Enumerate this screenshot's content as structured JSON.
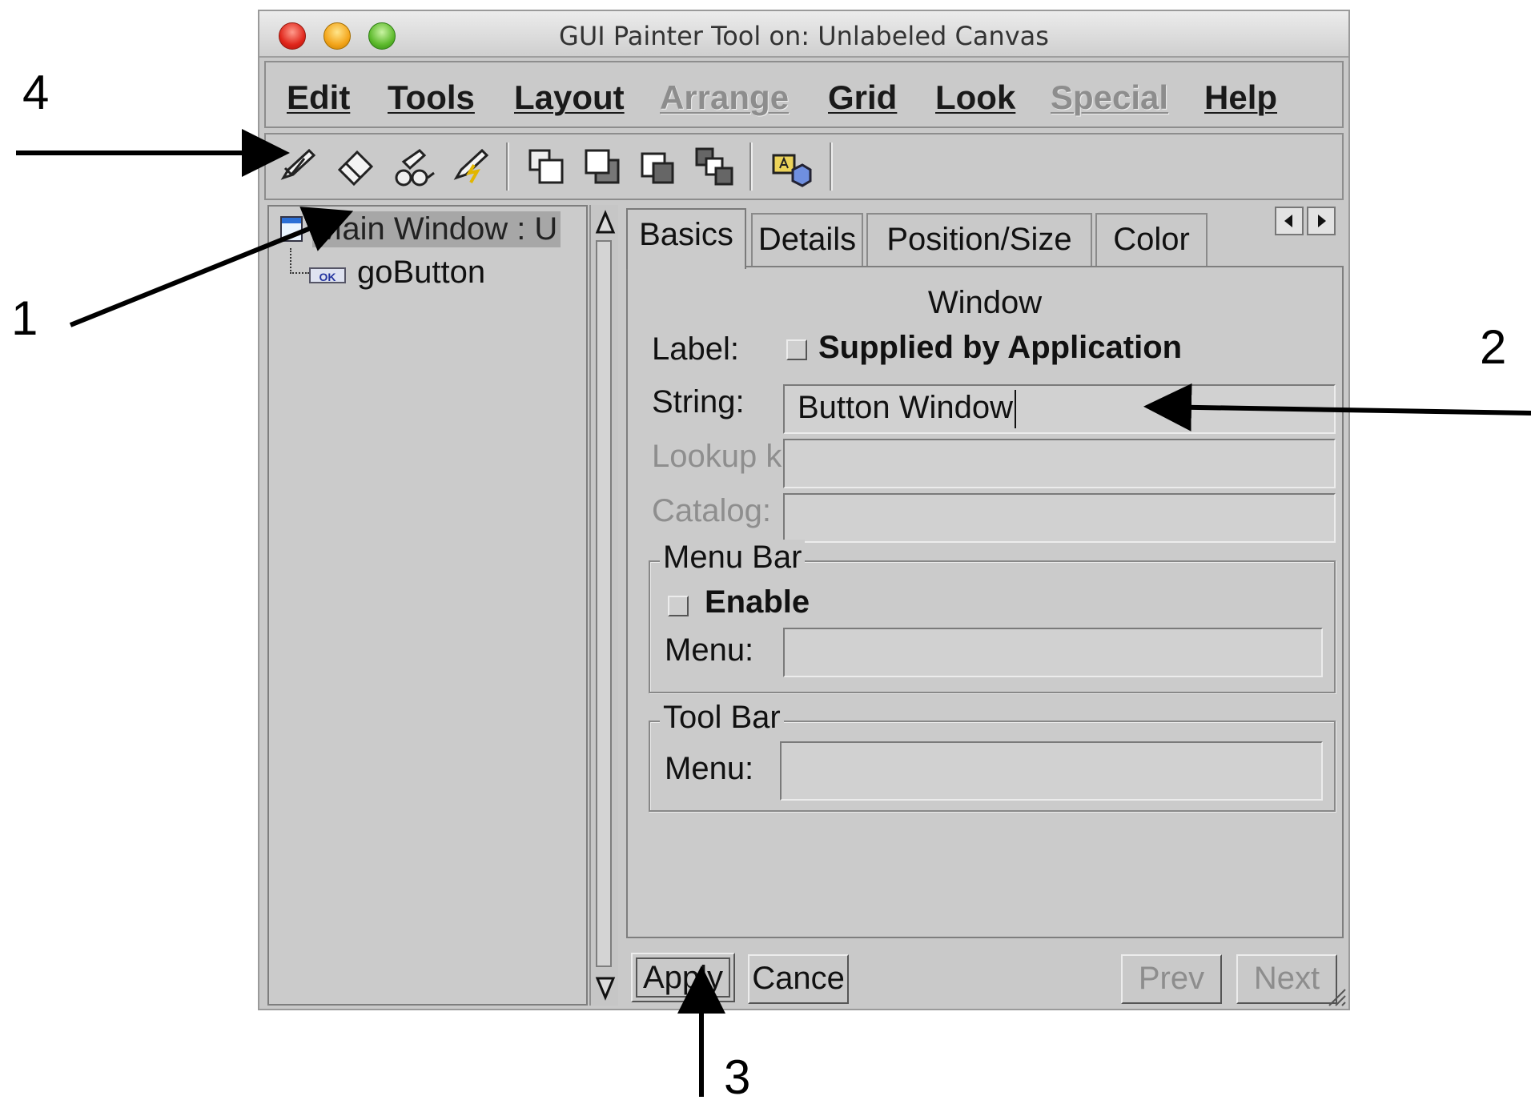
{
  "window": {
    "title": "GUI Painter Tool on: Unlabeled Canvas"
  },
  "menubar": {
    "items": [
      {
        "label": "Edit",
        "enabled": true
      },
      {
        "label": "Tools",
        "enabled": true
      },
      {
        "label": "Layout",
        "enabled": true
      },
      {
        "label": "Arrange",
        "enabled": false
      },
      {
        "label": "Grid",
        "enabled": true
      },
      {
        "label": "Look",
        "enabled": true
      },
      {
        "label": "Special",
        "enabled": false
      },
      {
        "label": "Help",
        "enabled": true
      }
    ]
  },
  "toolbar": {
    "tools": [
      "edit-pen-icon",
      "eraser-icon",
      "glasses-icon",
      "lightning-pen-icon",
      "bring-to-front-icon",
      "send-to-back-icon",
      "bring-forward-icon",
      "send-backward-icon",
      "resource-install-icon"
    ]
  },
  "tree": {
    "root_label": "Main Window : U",
    "child_badge": "OK",
    "child_label": "goButton"
  },
  "tabs": [
    {
      "label": "Basics",
      "active": true
    },
    {
      "label": "Details",
      "active": false
    },
    {
      "label": "Position/Size",
      "active": false
    },
    {
      "label": "Color",
      "active": false
    }
  ],
  "panel": {
    "heading": "Window",
    "label_label": "Label:",
    "supplied_checkbox_label": "Supplied by Application",
    "supplied_checked": false,
    "string_label": "String:",
    "string_value": "Button Window",
    "lookup_label": "Lookup key:",
    "lookup_value": "",
    "catalog_label": "Catalog:",
    "catalog_value": "",
    "menubar_group": {
      "title": "Menu Bar",
      "enable_label": "Enable",
      "enable_checked": false,
      "menu_label": "Menu:",
      "menu_value": ""
    },
    "toolbar_group": {
      "title": "Tool Bar",
      "menu_label": "Menu:",
      "menu_value": ""
    }
  },
  "buttons": {
    "apply": "Apply",
    "cancel": "Cance",
    "prev": "Prev",
    "next": "Next"
  },
  "callouts": [
    "1",
    "2",
    "3",
    "4"
  ]
}
